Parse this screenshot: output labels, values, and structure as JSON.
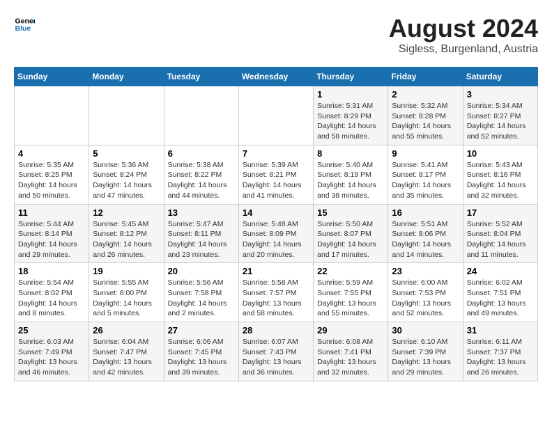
{
  "header": {
    "logo_line1": "General",
    "logo_line2": "Blue",
    "main_title": "August 2024",
    "subtitle": "Sigless, Burgenland, Austria"
  },
  "weekdays": [
    "Sunday",
    "Monday",
    "Tuesday",
    "Wednesday",
    "Thursday",
    "Friday",
    "Saturday"
  ],
  "weeks": [
    [
      {
        "day": "",
        "info": ""
      },
      {
        "day": "",
        "info": ""
      },
      {
        "day": "",
        "info": ""
      },
      {
        "day": "",
        "info": ""
      },
      {
        "day": "1",
        "info": "Sunrise: 5:31 AM\nSunset: 8:29 PM\nDaylight: 14 hours\nand 58 minutes."
      },
      {
        "day": "2",
        "info": "Sunrise: 5:32 AM\nSunset: 8:28 PM\nDaylight: 14 hours\nand 55 minutes."
      },
      {
        "day": "3",
        "info": "Sunrise: 5:34 AM\nSunset: 8:27 PM\nDaylight: 14 hours\nand 52 minutes."
      }
    ],
    [
      {
        "day": "4",
        "info": "Sunrise: 5:35 AM\nSunset: 8:25 PM\nDaylight: 14 hours\nand 50 minutes."
      },
      {
        "day": "5",
        "info": "Sunrise: 5:36 AM\nSunset: 8:24 PM\nDaylight: 14 hours\nand 47 minutes."
      },
      {
        "day": "6",
        "info": "Sunrise: 5:38 AM\nSunset: 8:22 PM\nDaylight: 14 hours\nand 44 minutes."
      },
      {
        "day": "7",
        "info": "Sunrise: 5:39 AM\nSunset: 8:21 PM\nDaylight: 14 hours\nand 41 minutes."
      },
      {
        "day": "8",
        "info": "Sunrise: 5:40 AM\nSunset: 8:19 PM\nDaylight: 14 hours\nand 38 minutes."
      },
      {
        "day": "9",
        "info": "Sunrise: 5:41 AM\nSunset: 8:17 PM\nDaylight: 14 hours\nand 35 minutes."
      },
      {
        "day": "10",
        "info": "Sunrise: 5:43 AM\nSunset: 8:16 PM\nDaylight: 14 hours\nand 32 minutes."
      }
    ],
    [
      {
        "day": "11",
        "info": "Sunrise: 5:44 AM\nSunset: 8:14 PM\nDaylight: 14 hours\nand 29 minutes."
      },
      {
        "day": "12",
        "info": "Sunrise: 5:45 AM\nSunset: 8:12 PM\nDaylight: 14 hours\nand 26 minutes."
      },
      {
        "day": "13",
        "info": "Sunrise: 5:47 AM\nSunset: 8:11 PM\nDaylight: 14 hours\nand 23 minutes."
      },
      {
        "day": "14",
        "info": "Sunrise: 5:48 AM\nSunset: 8:09 PM\nDaylight: 14 hours\nand 20 minutes."
      },
      {
        "day": "15",
        "info": "Sunrise: 5:50 AM\nSunset: 8:07 PM\nDaylight: 14 hours\nand 17 minutes."
      },
      {
        "day": "16",
        "info": "Sunrise: 5:51 AM\nSunset: 8:06 PM\nDaylight: 14 hours\nand 14 minutes."
      },
      {
        "day": "17",
        "info": "Sunrise: 5:52 AM\nSunset: 8:04 PM\nDaylight: 14 hours\nand 11 minutes."
      }
    ],
    [
      {
        "day": "18",
        "info": "Sunrise: 5:54 AM\nSunset: 8:02 PM\nDaylight: 14 hours\nand 8 minutes."
      },
      {
        "day": "19",
        "info": "Sunrise: 5:55 AM\nSunset: 8:00 PM\nDaylight: 14 hours\nand 5 minutes."
      },
      {
        "day": "20",
        "info": "Sunrise: 5:56 AM\nSunset: 7:58 PM\nDaylight: 14 hours\nand 2 minutes."
      },
      {
        "day": "21",
        "info": "Sunrise: 5:58 AM\nSunset: 7:57 PM\nDaylight: 13 hours\nand 58 minutes."
      },
      {
        "day": "22",
        "info": "Sunrise: 5:59 AM\nSunset: 7:55 PM\nDaylight: 13 hours\nand 55 minutes."
      },
      {
        "day": "23",
        "info": "Sunrise: 6:00 AM\nSunset: 7:53 PM\nDaylight: 13 hours\nand 52 minutes."
      },
      {
        "day": "24",
        "info": "Sunrise: 6:02 AM\nSunset: 7:51 PM\nDaylight: 13 hours\nand 49 minutes."
      }
    ],
    [
      {
        "day": "25",
        "info": "Sunrise: 6:03 AM\nSunset: 7:49 PM\nDaylight: 13 hours\nand 46 minutes."
      },
      {
        "day": "26",
        "info": "Sunrise: 6:04 AM\nSunset: 7:47 PM\nDaylight: 13 hours\nand 42 minutes."
      },
      {
        "day": "27",
        "info": "Sunrise: 6:06 AM\nSunset: 7:45 PM\nDaylight: 13 hours\nand 39 minutes."
      },
      {
        "day": "28",
        "info": "Sunrise: 6:07 AM\nSunset: 7:43 PM\nDaylight: 13 hours\nand 36 minutes."
      },
      {
        "day": "29",
        "info": "Sunrise: 6:08 AM\nSunset: 7:41 PM\nDaylight: 13 hours\nand 32 minutes."
      },
      {
        "day": "30",
        "info": "Sunrise: 6:10 AM\nSunset: 7:39 PM\nDaylight: 13 hours\nand 29 minutes."
      },
      {
        "day": "31",
        "info": "Sunrise: 6:11 AM\nSunset: 7:37 PM\nDaylight: 13 hours\nand 26 minutes."
      }
    ]
  ]
}
